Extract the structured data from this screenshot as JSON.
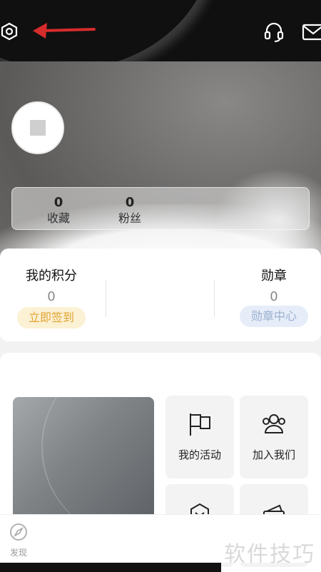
{
  "header": {
    "settings_icon": "gear-hex-icon",
    "headset_icon": "customer-service-icon",
    "mail_icon": "mail-icon",
    "annotation_color": "#d62c2c"
  },
  "profile": {
    "favorites": {
      "count": "0",
      "label": "收藏"
    },
    "fans": {
      "count": "0",
      "label": "粉丝"
    }
  },
  "points": {
    "title": "我的积分",
    "value": "0",
    "sign_in_label": "立即签到",
    "sign_color": "#e2a533"
  },
  "medals": {
    "title": "勋章",
    "value": "0",
    "center_label": "勋章中心",
    "color": "#9ab0cf"
  },
  "services": {
    "tiles": [
      {
        "label": "我的活动",
        "icon": "flag-icon"
      },
      {
        "label": "加入我们",
        "icon": "group-icon"
      },
      {
        "label": "",
        "icon": "hexagon-icon"
      },
      {
        "label": "",
        "icon": "wallet-icon"
      }
    ]
  },
  "bottom_nav": {
    "discover_label": "发现",
    "discover_icon": "compass-icon"
  },
  "watermark": "软件技巧"
}
